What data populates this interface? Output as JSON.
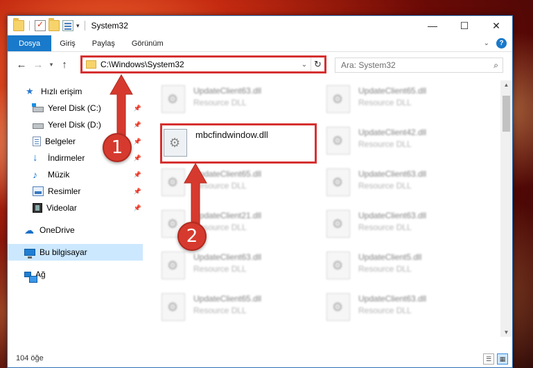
{
  "window": {
    "title": "System32",
    "controls": {
      "minimize": "—",
      "maximize": "☐",
      "close": "✕"
    }
  },
  "ribbon": {
    "tabs": [
      "Dosya",
      "Giriş",
      "Paylaş",
      "Görünüm"
    ]
  },
  "navigation": {
    "address": "C:\\Windows\\System32",
    "search_placeholder": "Ara: System32"
  },
  "sidebar": {
    "items": [
      {
        "label": "Hızlı erişim",
        "icon": "star-icon",
        "pinned": false
      },
      {
        "label": "Yerel Disk (C:)",
        "icon": "drive-c-icon",
        "pinned": true
      },
      {
        "label": "Yerel Disk (D:)",
        "icon": "drive-d-icon",
        "pinned": true
      },
      {
        "label": "Belgeler",
        "icon": "documents-icon",
        "pinned": true
      },
      {
        "label": "İndirmeler",
        "icon": "download-icon",
        "pinned": true
      },
      {
        "label": "Müzik",
        "icon": "music-icon",
        "pinned": true
      },
      {
        "label": "Resimler",
        "icon": "pictures-icon",
        "pinned": true
      },
      {
        "label": "Videolar",
        "icon": "videos-icon",
        "pinned": true
      },
      {
        "label": "OneDrive",
        "icon": "onedrive-icon",
        "pinned": false
      },
      {
        "label": "Bu bilgisayar",
        "icon": "this-pc-icon",
        "pinned": false,
        "selected": true
      },
      {
        "label": "Ağ",
        "icon": "network-icon",
        "pinned": false
      }
    ]
  },
  "files": {
    "highlighted": {
      "name": "mbcfindwindow.dll",
      "type": ""
    },
    "left_column": [
      {
        "name": "UpdateClient63.dll",
        "type": "Resource DLL"
      },
      {
        "name": "UpdateClient65.dll",
        "type": "Resource DLL"
      },
      {
        "name": "UpdateClient21.dll",
        "type": "Resource DLL"
      },
      {
        "name": "UpdateClient63.dll",
        "type": "Resource DLL"
      },
      {
        "name": "UpdateClient65.dll",
        "type": "Resource DLL"
      }
    ],
    "right_column": [
      {
        "name": "UpdateClient65.dll",
        "type": "Resource DLL"
      },
      {
        "name": "UpdateClient42.dll",
        "type": "Resource DLL"
      },
      {
        "name": "UpdateClient63.dll",
        "type": "Resource DLL"
      },
      {
        "name": "UpdateClient63.dll",
        "type": "Resource DLL"
      },
      {
        "name": "UpdateClient5.dll",
        "type": "Resource DLL"
      },
      {
        "name": "UpdateClient63.dll",
        "type": "Resource DLL"
      }
    ]
  },
  "status": {
    "item_count": "104 öğe"
  },
  "callouts": {
    "step1": "1",
    "step2": "2"
  },
  "colors": {
    "accent": "#1979ca",
    "highlight": "#d63030",
    "callout": "#d63a2e",
    "selected": "#cce8ff"
  }
}
